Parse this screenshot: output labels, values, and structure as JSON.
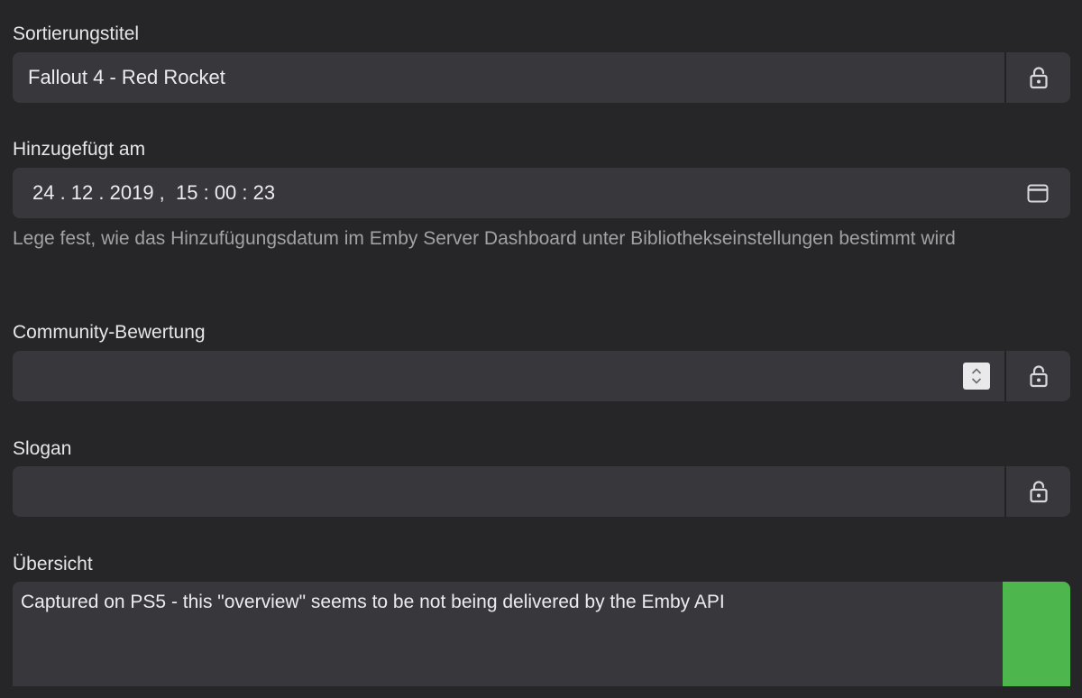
{
  "sort_title": {
    "label": "Sortierungstitel",
    "value": "Fallout 4 - Red Rocket",
    "lock_icon": "lock-open-icon"
  },
  "date_added": {
    "label": "Hinzugefügt am",
    "value": "24 . 12 . 2019 ,  15 : 00 : 23",
    "calendar_icon": "calendar-icon",
    "help": "Lege fest, wie das Hinzufügungsdatum im Emby Server Dashboard unter Bibliothekseinstellungen bestimmt wird"
  },
  "community_rating": {
    "label": "Community-Bewertung",
    "value": "",
    "lock_icon": "lock-open-icon"
  },
  "tagline": {
    "label": "Slogan",
    "value": "",
    "lock_icon": "lock-open-icon"
  },
  "overview": {
    "label": "Übersicht",
    "value": "Captured on PS5 - this \"overview\" seems to be not being delivered by the Emby API",
    "accent_color": "#4db64c"
  }
}
